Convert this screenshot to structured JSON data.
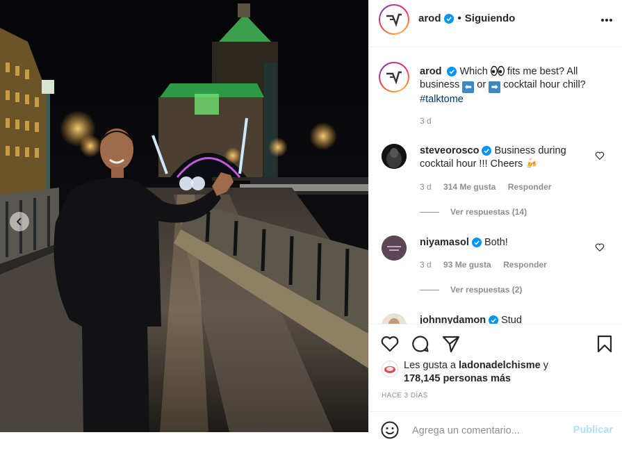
{
  "post": {
    "username": "arod",
    "follow_status": "Siguiendo",
    "separator": "•",
    "more_label": "Más opciones"
  },
  "caption": {
    "username": "arod",
    "text_part1": "Which",
    "text_part2": "fits me best? All business",
    "text_or": "or",
    "text_part3": "cocktail hour chill?",
    "hashtag": "#talktome",
    "time": "3 d",
    "emoji_left": "⬅",
    "emoji_right": "➡"
  },
  "comments": [
    {
      "username": "steveorosco",
      "text": "Business during cocktail hour !!! Cheers 🍻",
      "time": "3 d",
      "likes": "314 Me gusta",
      "reply": "Responder",
      "view_replies": "Ver respuestas (14)"
    },
    {
      "username": "niyamasol",
      "text": "Both!",
      "time": "3 d",
      "likes": "93 Me gusta",
      "reply": "Responder",
      "view_replies": "Ver respuestas (2)"
    },
    {
      "username": "johnnydamon",
      "text": "Stud"
    }
  ],
  "likes": {
    "prefix": "Les gusta a",
    "user": "ladonadelchisme",
    "and": "y",
    "count": "178,145 personas más"
  },
  "post_time": "HACE 3 DÍAS",
  "comment_box": {
    "placeholder": "Agrega un comentario...",
    "publish_label": "Publicar"
  },
  "colors": {
    "verified": "#0095f6",
    "link": "#00376b",
    "muted": "#8e8e8e",
    "publish_disabled": "#b2dffc"
  },
  "icons": [
    "heart-icon",
    "comment-icon",
    "share-icon",
    "bookmark-icon",
    "emoji-icon",
    "more-icon",
    "verified-icon",
    "chevron-left-icon"
  ]
}
